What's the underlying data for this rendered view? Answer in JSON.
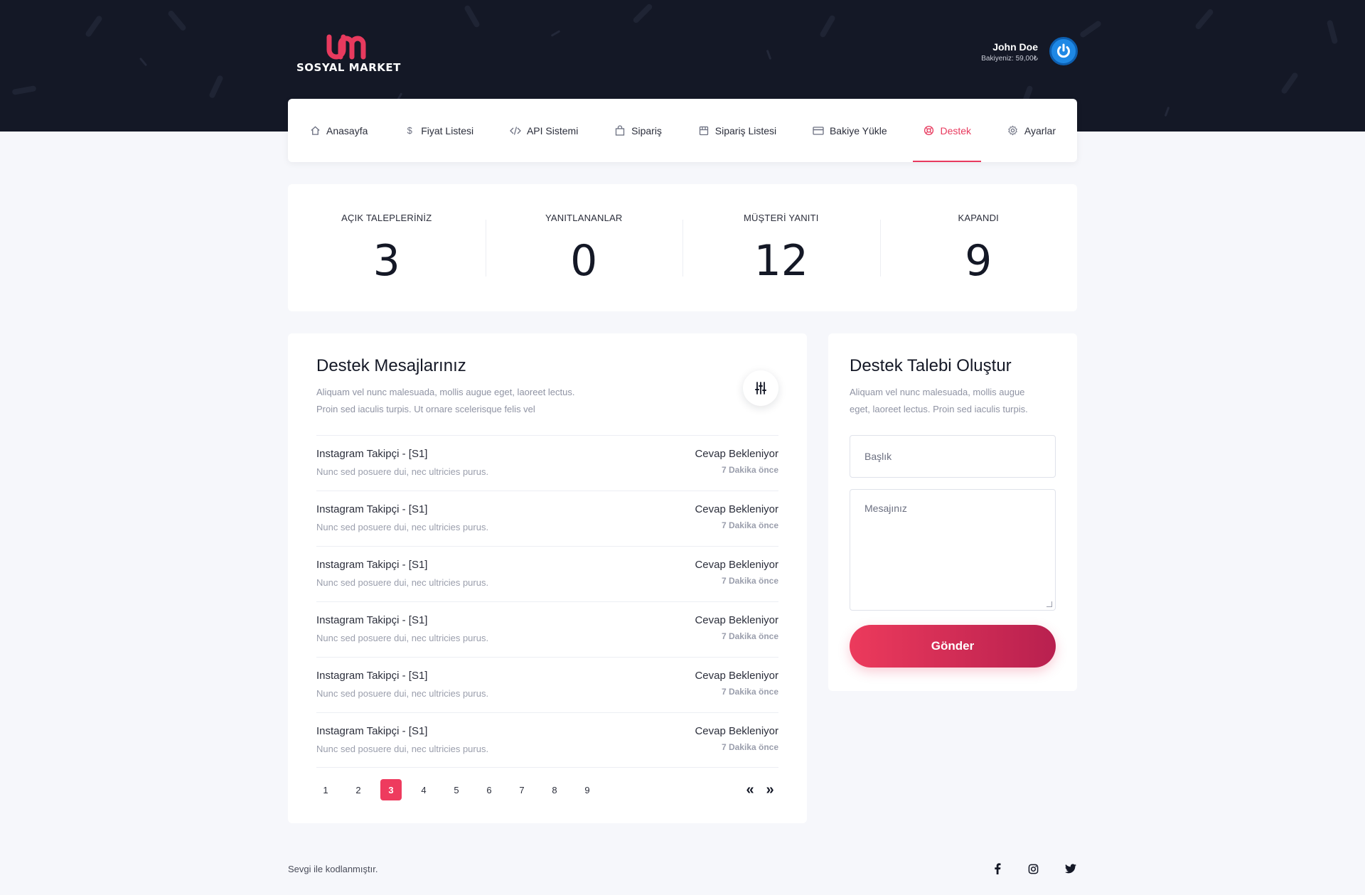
{
  "brand": {
    "name": "SOSYAL MARKET",
    "mark": "um",
    "accent_color": "#e83a5e",
    "header_bg": "#141826"
  },
  "user": {
    "name": "John Doe",
    "balance": "Bakiyeniz: 59,00₺",
    "avatar_icon": "power-icon"
  },
  "nav": {
    "items": [
      {
        "label": "Anasayfa",
        "icon": "home-icon",
        "active": false
      },
      {
        "label": "Fiyat Listesi",
        "icon": "dollar-icon",
        "active": false
      },
      {
        "label": "API Sistemi",
        "icon": "code-icon",
        "active": false
      },
      {
        "label": "Sipariş",
        "icon": "bag-icon",
        "active": false
      },
      {
        "label": "Sipariş Listesi",
        "icon": "box-icon",
        "active": false
      },
      {
        "label": "Bakiye Yükle",
        "icon": "credit-card-icon",
        "active": false
      },
      {
        "label": "Destek",
        "icon": "lifebuoy-icon",
        "active": true
      },
      {
        "label": "Ayarlar",
        "icon": "gear-icon",
        "active": false
      }
    ]
  },
  "stats": [
    {
      "label": "AÇIK TALEPLERİNİZ",
      "value": "3"
    },
    {
      "label": "YANITLANANLAR",
      "value": "0"
    },
    {
      "label": "MÜŞTERİ YANITI",
      "value": "12"
    },
    {
      "label": "KAPANDI",
      "value": "9"
    }
  ],
  "messages": {
    "title": "Destek Mesajlarınız",
    "desc_line1": "Aliquam vel nunc malesuada, mollis augue eget, laoreet lectus.",
    "desc_line2": "Proin sed iaculis turpis. Ut ornare scelerisque felis vel",
    "filter_icon": "sliders-icon",
    "rows": [
      {
        "title": "Instagram Takipçi - [S1]",
        "subtitle": "Nunc sed posuere dui, nec ultricies purus.",
        "status": "Cevap Bekleniyor",
        "time": "7 Dakika önce"
      },
      {
        "title": "Instagram Takipçi - [S1]",
        "subtitle": "Nunc sed posuere dui, nec ultricies purus.",
        "status": "Cevap Bekleniyor",
        "time": "7 Dakika önce"
      },
      {
        "title": "Instagram Takipçi - [S1]",
        "subtitle": "Nunc sed posuere dui, nec ultricies purus.",
        "status": "Cevap Bekleniyor",
        "time": "7 Dakika önce"
      },
      {
        "title": "Instagram Takipçi - [S1]",
        "subtitle": "Nunc sed posuere dui, nec ultricies purus.",
        "status": "Cevap Bekleniyor",
        "time": "7 Dakika önce"
      },
      {
        "title": "Instagram Takipçi - [S1]",
        "subtitle": "Nunc sed posuere dui, nec ultricies purus.",
        "status": "Cevap Bekleniyor",
        "time": "7 Dakika önce"
      },
      {
        "title": "Instagram Takipçi - [S1]",
        "subtitle": "Nunc sed posuere dui, nec ultricies purus.",
        "status": "Cevap Bekleniyor",
        "time": "7 Dakika önce"
      }
    ],
    "pages": [
      "1",
      "2",
      "3",
      "4",
      "5",
      "6",
      "7",
      "8",
      "9"
    ],
    "current_page": "3",
    "prev_label": "«",
    "next_label": "»"
  },
  "create": {
    "title": "Destek Talebi Oluştur",
    "desc_line1": "Aliquam vel nunc malesuada, mollis augue",
    "desc_line2": "eget, laoreet lectus. Proin sed iaculis turpis.",
    "subject_placeholder": "Başlık",
    "message_placeholder": "Mesajınız",
    "submit_label": "Gönder"
  },
  "footer": {
    "text": "Sevgi ile kodlanmıştır.",
    "social": [
      "facebook-icon",
      "instagram-icon",
      "twitter-icon"
    ]
  }
}
